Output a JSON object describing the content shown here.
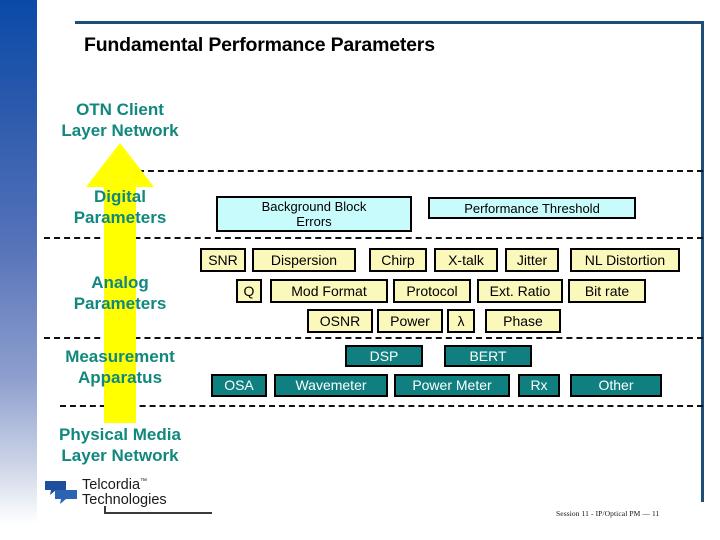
{
  "slide": {
    "title": "Fundamental Performance Parameters",
    "accent_navy": "#1f4e79",
    "label_teal": "#11887d",
    "arrow_color": "#ffff00",
    "cyan_fill": "#c8fbfb",
    "yellow_fill": "#fbf8bb",
    "teal_fill": "#0f7f7f"
  },
  "layers": [
    {
      "label": "OTN Client\nLayer Network"
    },
    {
      "label": "Digital\nParameters"
    },
    {
      "label": "Analog\nParameters"
    },
    {
      "label": "Measurement\nApparatus"
    },
    {
      "label": "Physical Media\nLayer Network"
    }
  ],
  "rows": {
    "digital": [
      {
        "label": "Background Block\nErrors",
        "style": "cyan"
      },
      {
        "label": "Performance Threshold",
        "style": "cyan"
      }
    ],
    "analog_row1": [
      {
        "label": "SNR",
        "style": "yellow"
      },
      {
        "label": "Dispersion",
        "style": "yellow"
      },
      {
        "label": "Chirp",
        "style": "yellow"
      },
      {
        "label": "X-talk",
        "style": "yellow"
      },
      {
        "label": "Jitter",
        "style": "yellow"
      },
      {
        "label": "NL Distortion",
        "style": "yellow"
      }
    ],
    "analog_row2": [
      {
        "label": "Q",
        "style": "yellow"
      },
      {
        "label": "Mod Format",
        "style": "yellow"
      },
      {
        "label": "Protocol",
        "style": "yellow"
      },
      {
        "label": "Ext. Ratio",
        "style": "yellow"
      },
      {
        "label": "Bit rate",
        "style": "yellow"
      }
    ],
    "analog_row3": [
      {
        "label": "OSNR",
        "style": "yellow"
      },
      {
        "label": "Power",
        "style": "yellow"
      },
      {
        "label": "λ",
        "style": "yellow"
      },
      {
        "label": "Phase",
        "style": "yellow"
      }
    ],
    "apparatus_row1": [
      {
        "label": "DSP",
        "style": "teal"
      },
      {
        "label": "BERT",
        "style": "teal"
      }
    ],
    "apparatus_row2": [
      {
        "label": "OSA",
        "style": "teal"
      },
      {
        "label": "Wavemeter",
        "style": "teal"
      },
      {
        "label": "Power Meter",
        "style": "teal"
      },
      {
        "label": "Rx",
        "style": "teal"
      },
      {
        "label": "Other",
        "style": "teal"
      }
    ]
  },
  "logo": {
    "line1": "Telcordia",
    "line2": "Technologies",
    "tm": "™"
  },
  "footer": {
    "text": "Session 11 - IP/Optical PM — 11"
  }
}
